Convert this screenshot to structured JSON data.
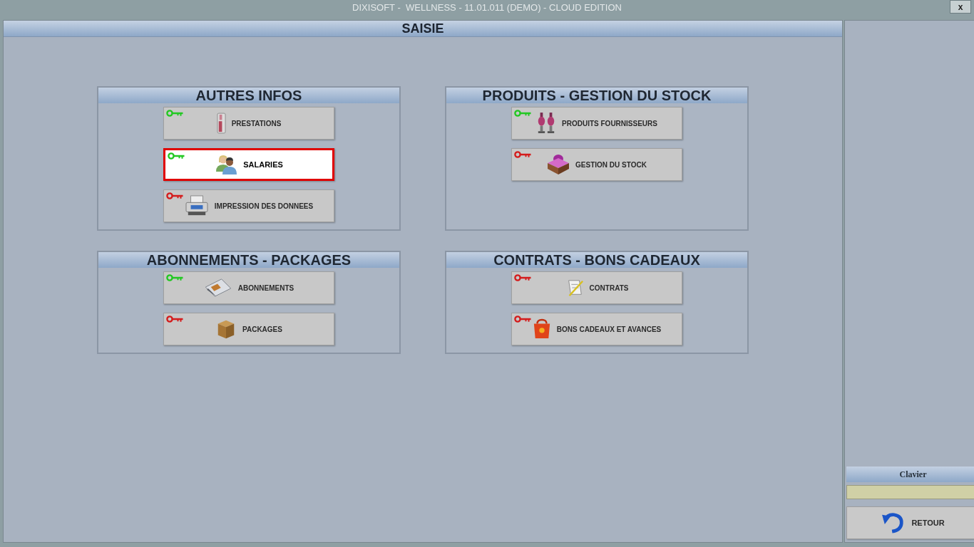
{
  "window": {
    "title": "DIXISOFT -  WELLNESS - 11.01.011 (DEMO) - CLOUD EDITION",
    "close": "x"
  },
  "main": {
    "title": "SAISIE",
    "groups": [
      {
        "title": "AUTRES INFOS",
        "buttons": [
          {
            "label": "PRESTATIONS",
            "color": "#22c822",
            "selected": false
          },
          {
            "label": "SALARIES",
            "color": "#22c822",
            "selected": true
          },
          {
            "label": "IMPRESSION DES DONNEES",
            "color": "#d41c1c",
            "selected": false
          }
        ]
      },
      {
        "title": "PRODUITS - GESTION DU STOCK",
        "buttons": [
          {
            "label": "PRODUITS FOURNISSEURS",
            "color": "#22c822",
            "selected": false
          },
          {
            "label": "GESTION DU STOCK",
            "color": "#d41c1c",
            "selected": false
          }
        ]
      },
      {
        "title": "ABONNEMENTS - PACKAGES",
        "buttons": [
          {
            "label": "ABONNEMENTS",
            "color": "#22c822",
            "selected": false
          },
          {
            "label": "PACKAGES",
            "color": "#d41c1c",
            "selected": false
          }
        ]
      },
      {
        "title": "CONTRATS - BONS CADEAUX",
        "buttons": [
          {
            "label": "CONTRATS",
            "color": "#d41c1c",
            "selected": false
          },
          {
            "label": "BONS CADEAUX ET AVANCES",
            "color": "#d41c1c",
            "selected": false
          }
        ]
      }
    ]
  },
  "side": {
    "keyboard_title": "Clavier",
    "back_button": "RETOUR"
  }
}
